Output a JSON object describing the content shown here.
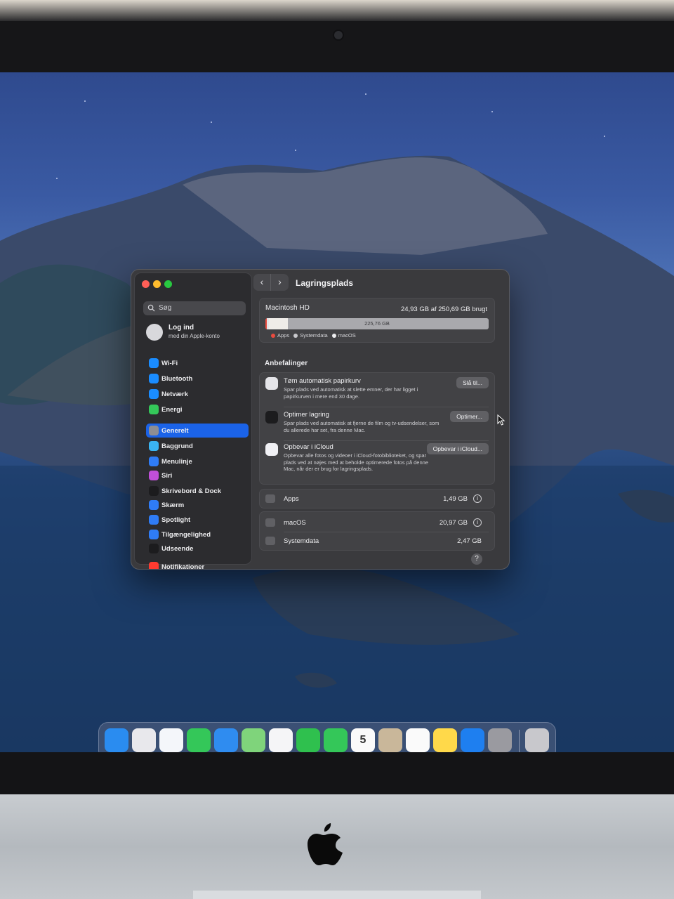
{
  "window": {
    "title": "Lagringsplads",
    "nav_back": "‹",
    "nav_forward": "›"
  },
  "sidebar": {
    "search_placeholder": "Søg",
    "account_title": "Log ind",
    "account_subtitle": "med din Apple-konto",
    "items": [
      {
        "label": "Wi-Fi",
        "icon": "wifi-icon",
        "color": "#1a8cff"
      },
      {
        "label": "Bluetooth",
        "icon": "bluetooth-icon",
        "color": "#1a8cff"
      },
      {
        "label": "Netværk",
        "icon": "network-icon",
        "color": "#1a8cff"
      },
      {
        "label": "Energi",
        "icon": "battery-icon",
        "color": "#34c759"
      },
      {
        "label": "Generelt",
        "icon": "gear-icon",
        "color": "#8e8e93"
      },
      {
        "label": "Baggrund",
        "icon": "wallpaper-icon",
        "color": "#3ab4f2"
      },
      {
        "label": "Menulinje",
        "icon": "menubar-icon",
        "color": "#2f7cf6"
      },
      {
        "label": "Siri",
        "icon": "siri-icon",
        "color": "#c04fd8"
      },
      {
        "label": "Skrivebord & Dock",
        "icon": "dock-icon",
        "color": "#1c1c1e"
      },
      {
        "label": "Skærm",
        "icon": "display-icon",
        "color": "#2f7cf6"
      },
      {
        "label": "Spotlight",
        "icon": "spotlight-icon",
        "color": "#2f7cf6"
      },
      {
        "label": "Tilgængelighed",
        "icon": "accessibility-icon",
        "color": "#2f7cf6"
      },
      {
        "label": "Udseende",
        "icon": "appearance-icon",
        "color": "#1c1c1e"
      },
      {
        "label": "Notifikationer",
        "icon": "notifications-icon",
        "color": "#ff3b30"
      }
    ],
    "active_index": 4
  },
  "storage": {
    "disk_name": "Macintosh HD",
    "usage_text": "24,93 GB af 250,69 GB brugt",
    "free_label": "225,76 GB",
    "total_gb": 250.69,
    "apps_gb": 1.49,
    "systemdata_gb": 2.47,
    "macos_gb": 20.97,
    "legend": [
      {
        "label": "Apps",
        "color": "#ea4b3f"
      },
      {
        "label": "Systemdata",
        "color": "#c8c8cc"
      },
      {
        "label": "macOS",
        "color": "#ececee"
      }
    ]
  },
  "recommendations": {
    "heading": "Anbefalinger",
    "items": [
      {
        "title": "Tøm automatisk papirkurv",
        "description": "Spar plads ved automatisk at slette emner, der har ligget i papirkurven i mere end 30 dage.",
        "button": "Slå til...",
        "icon": "trash-icon"
      },
      {
        "title": "Optimer lagring",
        "description": "Spar plads ved automatisk at fjerne de film og tv-udsendelser, som du allerede har set, fra denne Mac.",
        "button": "Optimer...",
        "icon": "appletv-icon"
      },
      {
        "title": "Opbevar i iCloud",
        "description": "Opbevar alle fotos og videoer i iCloud-fotobiblioteket, og spar plads ved at nøjes med at beholde optimerede fotos på denne Mac, når der er brug for lagringsplads.",
        "button": "Opbevar i iCloud...",
        "icon": "icloud-icon"
      }
    ]
  },
  "categories": [
    {
      "label": "Apps",
      "value": "1,49 GB",
      "info": "i"
    },
    {
      "label": "macOS",
      "value": "20,97 GB",
      "info": "i"
    },
    {
      "label": "Systemdata",
      "value": "2,47 GB"
    }
  ],
  "help_label": "?",
  "dock": {
    "apps": [
      {
        "name": "finder",
        "bg": "#2a8cf0",
        "glyph": ""
      },
      {
        "name": "launchpad",
        "bg": "#e8e8ec",
        "glyph": ""
      },
      {
        "name": "safari",
        "bg": "#f4f6fa",
        "glyph": ""
      },
      {
        "name": "messages",
        "bg": "#34c759",
        "glyph": ""
      },
      {
        "name": "mail",
        "bg": "#2f8cf0",
        "glyph": ""
      },
      {
        "name": "maps",
        "bg": "#7fd47b",
        "glyph": ""
      },
      {
        "name": "photos",
        "bg": "#f5f5f7",
        "glyph": ""
      },
      {
        "name": "facetime",
        "bg": "#2fc04e",
        "glyph": ""
      },
      {
        "name": "phone",
        "bg": "#34c759",
        "glyph": ""
      },
      {
        "name": "calendar",
        "bg": "#fafafa",
        "glyph": "5"
      },
      {
        "name": "contacts",
        "bg": "#c9b79a",
        "glyph": ""
      },
      {
        "name": "reminders",
        "bg": "#fafafa",
        "glyph": ""
      },
      {
        "name": "notes",
        "bg": "#ffd94a",
        "glyph": ""
      },
      {
        "name": "app-store",
        "bg": "#1e7ff0",
        "glyph": ""
      },
      {
        "name": "system-settings",
        "bg": "#9a9aa0",
        "glyph": ""
      },
      {
        "name": "trash",
        "bg": "#c8c8cc",
        "glyph": ""
      }
    ]
  }
}
